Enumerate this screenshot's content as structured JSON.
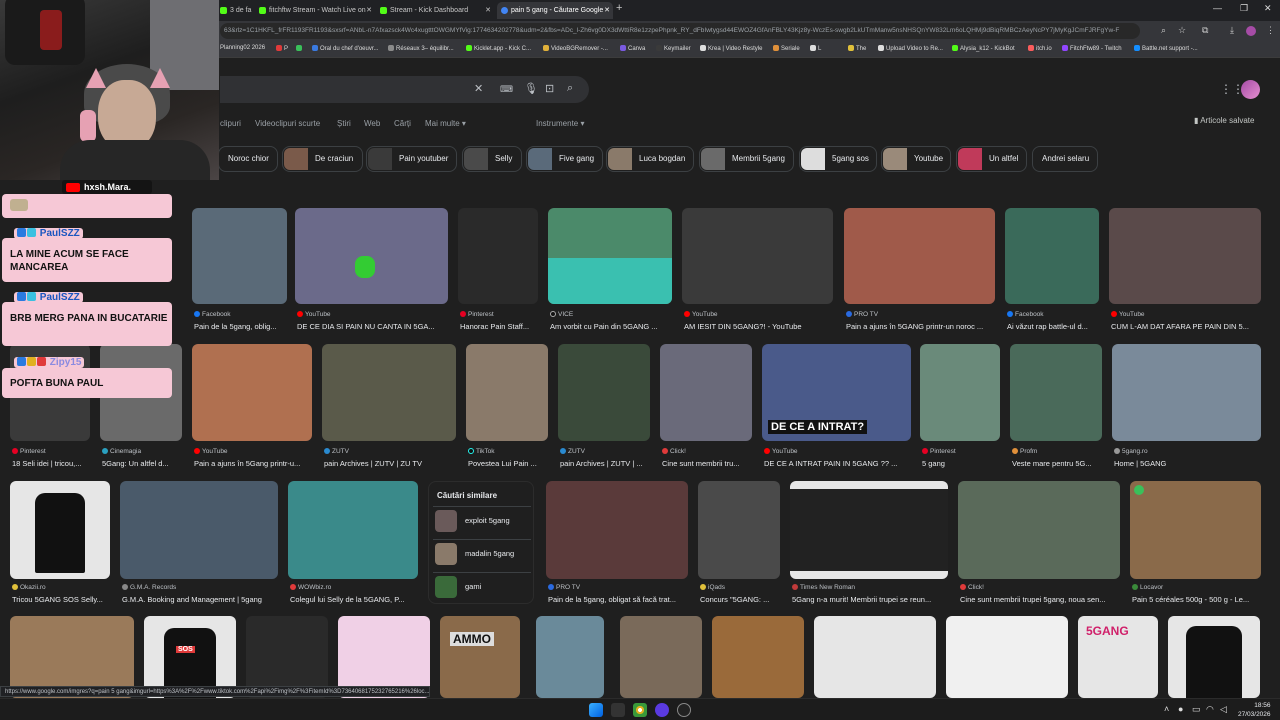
{
  "tabs": [
    {
      "label": "3 de fa",
      "color": "#53fc18"
    },
    {
      "label": "fitchftw Stream - Watch Live on",
      "color": "#53fc18"
    },
    {
      "label": "Stream - Kick Dashboard",
      "color": "#53fc18"
    },
    {
      "label": "pain 5 gang - Căutare Google",
      "color": "#4285f4"
    }
  ],
  "url": "63&rlz=1C1HKFL_frFR1193FR1193&sxsrf=ANbL-n7Afxazsck4Wc4xugtttOWGMYfVig:1774634202778&udm=2&fbs=ADc_l-Zh6vg0DX3dWttiR8e1zzpePhpnk_RY_dFbIwtygsd44EWOZ4GfAnFBLY43Kjz8y-WczEs-swgb2LkUTmManw5nsNHSQnYW832Lm6oLQHMj9dBiqRMBCzAeyNcPY7jMyKgJCmFJRFgYw-F",
  "bookmarks": [
    "Planning02 2026",
    "P",
    "",
    "Oral du chef d'oeuvr...",
    "Réseaux 3– équilibr...",
    "Kicklet.app - Kick C...",
    "VideoBGRemover -...",
    "Canva",
    "Keymailer",
    "Krea | Video Restyle",
    "Seriale",
    "L",
    "The",
    "Upload Video to Re...",
    "Alysia_k12 - KickBot",
    "itch.io",
    "FitchFtw89 - Twitch",
    "Battle.net support -..."
  ],
  "search": {
    "query": "pain 5 gang"
  },
  "nav_tabs": [
    "clipuri",
    "Videoclipuri scurte",
    "Știri",
    "Web",
    "Cărți",
    "Mai multe ▾"
  ],
  "tools_label": "Instrumente ▾",
  "saved_label": "Articole salvate",
  "chips": [
    "Noroc chior",
    "De craciun",
    "Pain youtuber",
    "Selly",
    "Five gang",
    "Luca bogdan",
    "Membrii 5gang",
    "5gang sos",
    "Youtube",
    "Un altfel",
    "Andrei selaru"
  ],
  "results": [
    {
      "src": "Facebook",
      "cap": "Pain de la 5gang, oblig...",
      "color": "#5a6a78"
    },
    {
      "src": "YouTube",
      "cap": "DE CE DIA SI PAIN NU CANTA IN 5GA...",
      "color": "#6b6a8a"
    },
    {
      "src": "Pinterest",
      "cap": "Hanorac Pain Staff...",
      "color": "#2a2a2a"
    },
    {
      "src": "VICE",
      "cap": "Am vorbit cu Pain din 5GANG ...",
      "color": "#4b8a6a"
    },
    {
      "src": "YouTube",
      "cap": "AM IESIT DIN 5GANG?! - YouTube",
      "color": "#3a3a3a"
    },
    {
      "src": "PRO TV",
      "cap": "Pain a ajuns în 5GANG printr-un noroc ...",
      "color": "#a05a4a"
    },
    {
      "src": "Facebook",
      "cap": "Ai văzut rap battle-ul d...",
      "color": "#3a6a5a"
    },
    {
      "src": "YouTube",
      "cap": "CUM L-AM DAT AFARA PE PAIN DIN 5...",
      "color": "#5a4a4a"
    },
    {
      "src": "Pinterest",
      "cap": "18 Seli idei | tricou,...",
      "color": "#3a3a3a"
    },
    {
      "src": "Cinemagia",
      "cap": "5Gang: Un altfel d...",
      "color": "#6a6a6a"
    },
    {
      "src": "YouTube",
      "cap": "Pain a ajuns în 5Gang printr-u...",
      "color": "#b07050"
    },
    {
      "src": "ZUTV",
      "cap": "pain Archives | ZUTV | ZU TV",
      "color": "#5a5a4a"
    },
    {
      "src": "TikTok",
      "cap": "Povestea Lui Pain ...",
      "color": "#8a7a6a"
    },
    {
      "src": "ZUTV",
      "cap": "pain Archives | ZUTV | ...",
      "color": "#3a4a3a"
    },
    {
      "src": "Click!",
      "cap": "Cine sunt membrii tru...",
      "color": "#6a6a7a"
    },
    {
      "src": "YouTube",
      "cap": "DE CE A INTRAT PAIN IN 5GANG ?? ...",
      "color": "#4a5a8a"
    },
    {
      "src": "Pinterest",
      "cap": "5 gang",
      "color": "#6a8a7a"
    },
    {
      "src": "Profm",
      "cap": "Veste mare pentru 5G...",
      "color": "#4a6a5a"
    },
    {
      "src": "5gang.ro",
      "cap": "Home | 5GANG",
      "color": "#7a8a9a"
    },
    {
      "src": "Okazii.ro",
      "cap": "Tricou 5GANG SOS Selly...",
      "color": "#e6e6e6"
    },
    {
      "src": "G.M.A. Records",
      "cap": "G.M.A. Booking and Management | 5gang",
      "color": "#4a5a6a"
    },
    {
      "src": "WOWbiz.ro",
      "cap": "Colegul lui Selly de la 5GANG, P...",
      "color": "#3a8a8a"
    },
    {
      "src": "PRO TV",
      "cap": "Pain de la 5gang, obligat să facă trat...",
      "color": "#5a3a3a"
    },
    {
      "src": "iQads",
      "cap": "Concurs \"5GANG: ...",
      "color": "#4a4a4a"
    },
    {
      "src": "Times New Roman",
      "cap": "5Gang n-a murit! Membrii trupei se reun...",
      "color": "#e6e6e6"
    },
    {
      "src": "Click!",
      "cap": "Cine sunt membrii trupei 5gang, noua sen...",
      "color": "#5a6a5a"
    },
    {
      "src": "Locavor",
      "cap": "Pain 5 céréales 500g - 500 g - Le...",
      "color": "#8a6a4a"
    }
  ],
  "related": {
    "title": "Căutări similare",
    "items": [
      "exploit 5gang",
      "madalin 5gang",
      "gami"
    ]
  },
  "overlay_text": {
    "sos": "SOS",
    "de_ce": "DE CE A INTRAT?",
    "fivegang": "5GANG",
    "ammo": "AMMO"
  },
  "status_url": "https://www.google.com/imgres?q=pain 5 gang&imgurl=https%3A%2F%2Fwww.tiktok.com%2Fapi%2Fimg%2F%3FitemId%3D7364068175232765216%26loc...",
  "clock": {
    "time": "18:56",
    "date": "27/03/2026"
  },
  "stream": {
    "streamer": "hxsh.Mara."
  },
  "chat": [
    {
      "user": "",
      "msg": ""
    },
    {
      "user": "PaulSZZ",
      "msg": "LA MINE ACUM SE FACE MANCAREA"
    },
    {
      "user": "PaulSZZ",
      "msg": "BRB MERG PANA IN BUCATARIE"
    },
    {
      "user": "Zipy15",
      "msg": "POFTA BUNA PAUL"
    }
  ]
}
